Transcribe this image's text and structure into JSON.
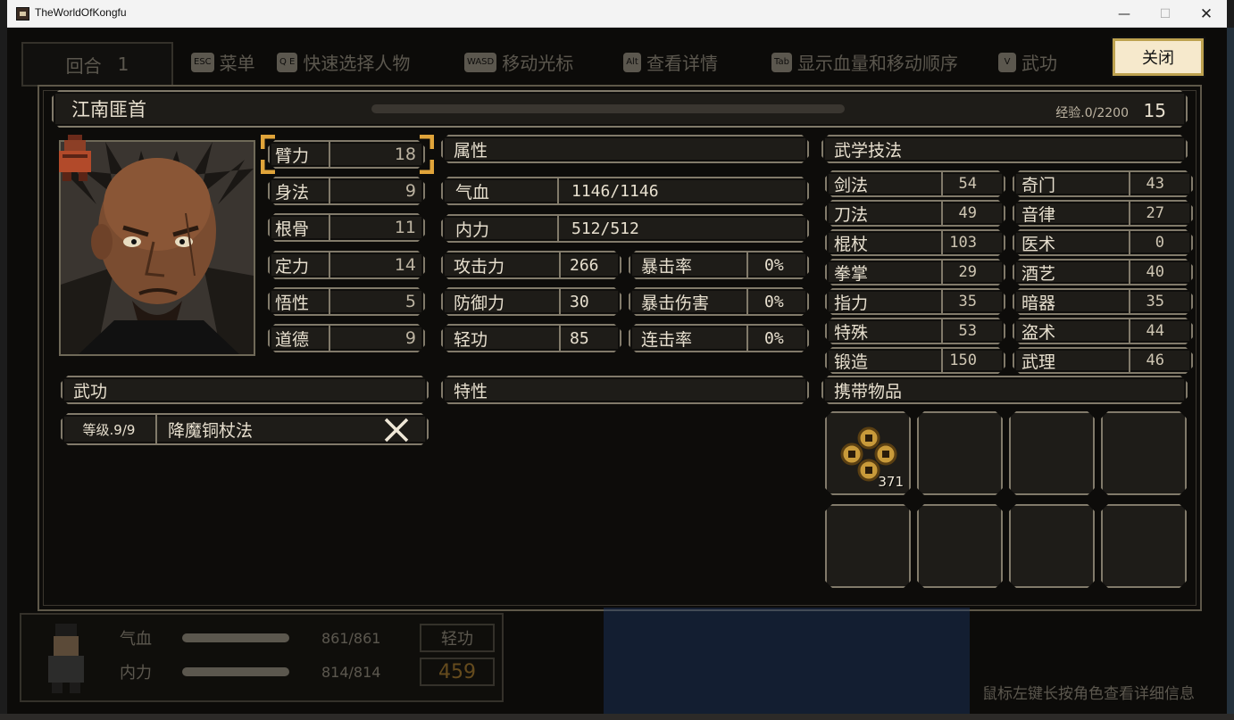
{
  "window": {
    "title": "TheWorldOfKongfu",
    "min": "—",
    "max": "☐",
    "close": "✕"
  },
  "hud_top": {
    "round_label": "回合",
    "round_value": "1",
    "hints": [
      {
        "key": "ESC",
        "label": "菜单"
      },
      {
        "key": "Q E",
        "label": "快速选择人物"
      },
      {
        "key": "WASD",
        "label": "移动光标"
      },
      {
        "key": "Alt",
        "label": "查看详情"
      },
      {
        "key": "Tab",
        "label": "显示血量和移动顺序"
      }
    ],
    "right_key": "V",
    "right_label": "武功"
  },
  "close_button": "关闭",
  "character": {
    "name": "江南匪首",
    "exp_label": "经验.0/2200",
    "level": "15",
    "exp_fraction": 0.0
  },
  "base_stats": [
    {
      "label": "臂力",
      "value": "18"
    },
    {
      "label": "身法",
      "value": "9"
    },
    {
      "label": "根骨",
      "value": "11"
    },
    {
      "label": "定力",
      "value": "14"
    },
    {
      "label": "悟性",
      "value": "5"
    },
    {
      "label": "道德",
      "value": "9"
    }
  ],
  "attributes": {
    "title": "属性",
    "hp_label": "气血",
    "hp_value": "1146/1146",
    "mp_label": "内力",
    "mp_value": "512/512",
    "atk_label": "攻击力",
    "atk_value": "266",
    "def_label": "防御力",
    "def_value": "30",
    "qg_label": "轻功",
    "qg_value": "85",
    "crit_label": "暴击率",
    "crit_value": "0%",
    "critdmg_label": "暴击伤害",
    "critdmg_value": "0%",
    "combo_label": "连击率",
    "combo_value": "0%"
  },
  "skills": {
    "title": "武学技法",
    "left": [
      {
        "label": "剑法",
        "value": "54"
      },
      {
        "label": "刀法",
        "value": "49"
      },
      {
        "label": "棍杖",
        "value": "103"
      },
      {
        "label": "拳掌",
        "value": "29"
      },
      {
        "label": "指力",
        "value": "35"
      },
      {
        "label": "特殊",
        "value": "53"
      },
      {
        "label": "锻造",
        "value": "150"
      }
    ],
    "right": [
      {
        "label": "奇门",
        "value": "43"
      },
      {
        "label": "音律",
        "value": "27"
      },
      {
        "label": "医术",
        "value": "0"
      },
      {
        "label": "酒艺",
        "value": "40"
      },
      {
        "label": "暗器",
        "value": "35"
      },
      {
        "label": "盗术",
        "value": "44"
      },
      {
        "label": "武理",
        "value": "46"
      }
    ]
  },
  "wugong": {
    "title": "武功",
    "level_label": "等级.9/9",
    "name": "降魔铜杖法"
  },
  "traits": {
    "title": "特性"
  },
  "items": {
    "title": "携带物品",
    "first_item_icon": "coins-icon",
    "first_item_count": "371"
  },
  "hud_bottom": {
    "hp_label": "气血",
    "hp_value": "861/861",
    "mp_label": "内力",
    "mp_value": "814/814",
    "qg_label": "轻功",
    "qg_value": "459",
    "status_text": "鼠标左键长按角色查看详细信息"
  },
  "colors": {
    "frame": "#817a6a",
    "panel_bg": "#1e1c18",
    "text": "#e8e0cf",
    "highlight": "#e0a43a",
    "close_bg": "#f6e9cc"
  }
}
